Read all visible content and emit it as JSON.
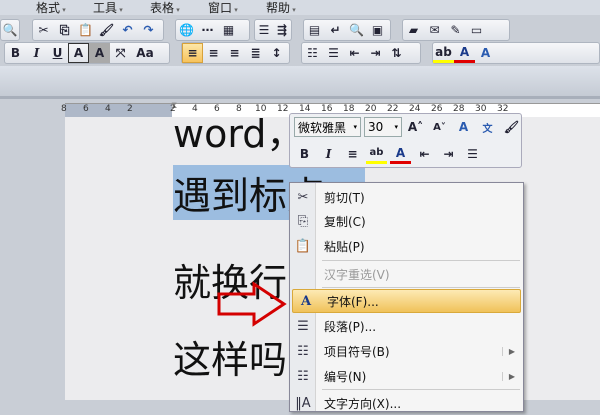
{
  "menubar": {
    "items": [
      "格式",
      "工具",
      "表格",
      "窗口",
      "帮助"
    ]
  },
  "toolbar": {
    "bold": "B",
    "italic": "I",
    "underline": "U",
    "char_border": "A",
    "char_shade": "A",
    "change_case": "Aa"
  },
  "ruler": {
    "ticks": [
      "8",
      "6",
      "4",
      "2",
      "2",
      "4",
      "6",
      "8",
      "10",
      "12",
      "14",
      "16",
      "18",
      "20",
      "22",
      "24",
      "26",
      "28",
      "30",
      "32"
    ]
  },
  "document": {
    "lines": [
      "word，",
      "遇到标点",
      "就换行怎",
      "这样吗"
    ]
  },
  "mini_toolbar": {
    "font": "微软雅黑",
    "size": "30",
    "bold": "B",
    "italic": "I"
  },
  "context_menu": {
    "items": [
      {
        "label": "剪切(T)",
        "icon": "scissors-icon"
      },
      {
        "label": "复制(C)",
        "icon": "copy-icon"
      },
      {
        "label": "粘贴(P)",
        "icon": "paste-icon"
      },
      {
        "label": "汉字重选(V)",
        "disabled": true
      },
      {
        "label": "字体(F)...",
        "icon": "font-icon",
        "highlighted": true
      },
      {
        "label": "段落(P)...",
        "icon": "paragraph-icon"
      },
      {
        "label": "项目符号(B)",
        "icon": "bullets-icon",
        "submenu": true
      },
      {
        "label": "编号(N)",
        "icon": "numbering-icon",
        "submenu": true
      },
      {
        "label": "文字方向(X)...",
        "icon": "text-direction-icon"
      }
    ]
  },
  "colors": {
    "highlight": "#ffff00",
    "font_color": "#e00000",
    "selection": "#9cbde0",
    "arrow": "#d40000"
  }
}
